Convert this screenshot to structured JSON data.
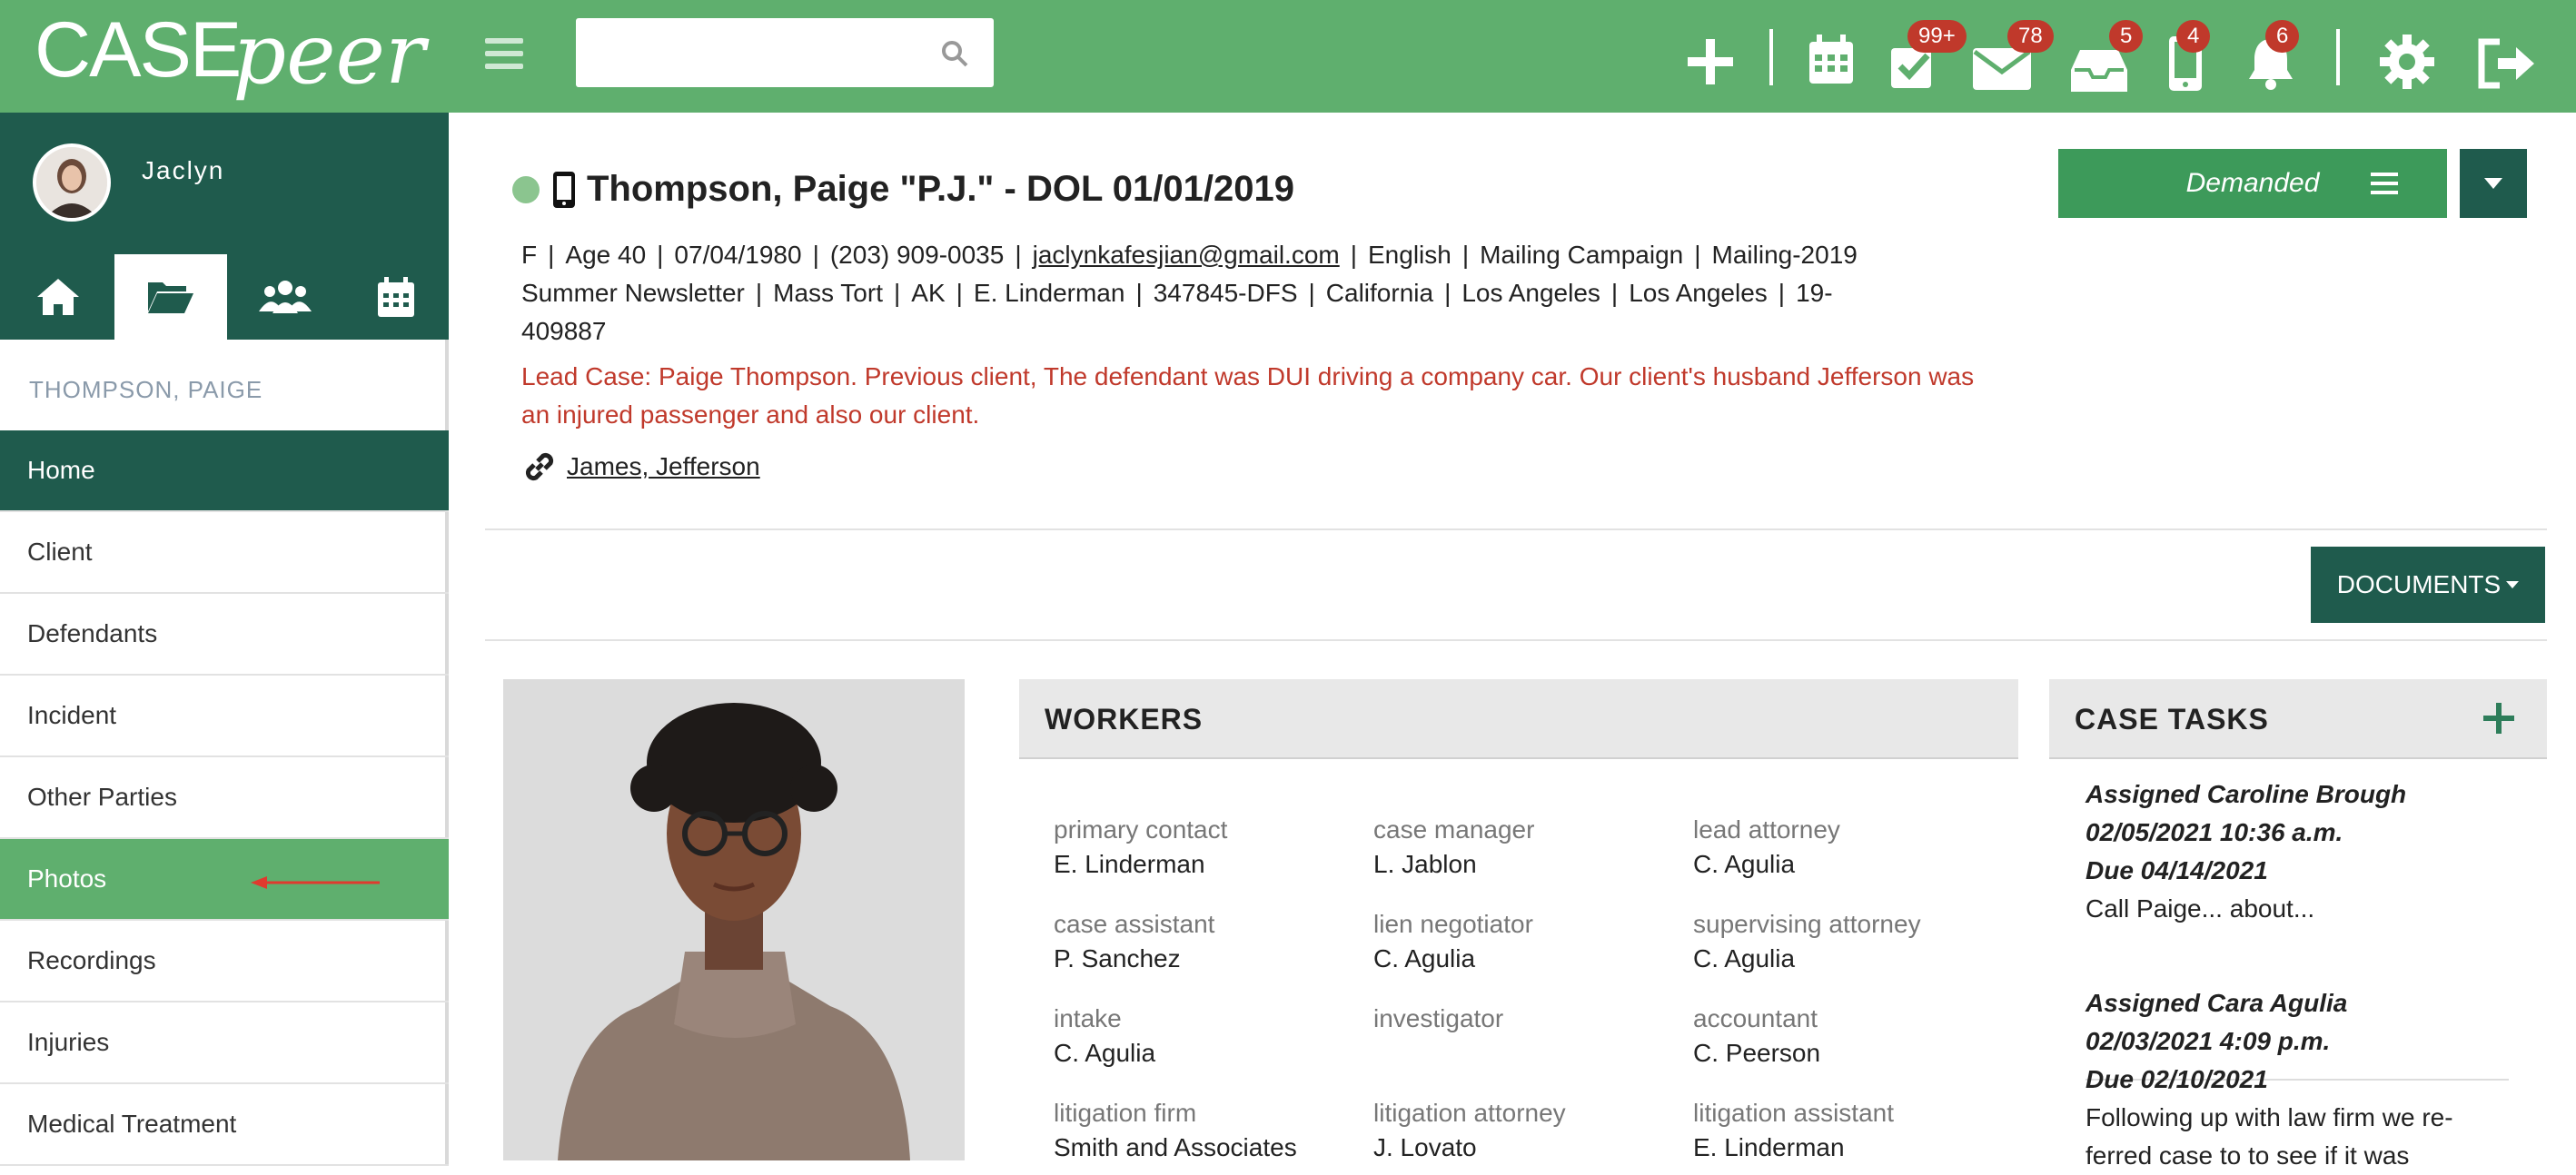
{
  "brand": {
    "case": "CASE",
    "peer": "peer"
  },
  "search": {
    "placeholder": ""
  },
  "badges": {
    "tasks": "99+",
    "mail": "78",
    "inbox": "5",
    "phone": "4",
    "notifications": "6"
  },
  "user": {
    "name": "Jaclyn"
  },
  "client_label": "THOMPSON, PAIGE",
  "nav": [
    "Home",
    "Client",
    "Defendants",
    "Incident",
    "Other Parties",
    "Photos",
    "Recordings",
    "Injuries",
    "Medical Treatment"
  ],
  "case": {
    "title": "Thompson, Paige \"P.J.\" - DOL 01/01/2019",
    "meta_line1": [
      "F",
      "Age 40",
      "07/04/1980",
      "(203) 909-0035"
    ],
    "email": "jaclynkafesjian@gmail.com",
    "meta_line1b": [
      "English",
      "Mailing Campaign",
      "Mailing-2019"
    ],
    "meta_line2": [
      "Summer Newsletter",
      "Mass Tort",
      "AK",
      "E. Linderman",
      "347845-DFS",
      "California",
      "Los Angeles",
      "Los Angeles",
      "19-"
    ],
    "meta_line3": "409887",
    "lead_note": "Lead Case: Paige Thompson. Previous client, The defendant was DUI driving a company car. Our client's husband Jefferson was an injured passenger and also our client.",
    "linked_case": "James, Jefferson",
    "status": "Demanded",
    "documents_label": "DOCUMENTS"
  },
  "workers": {
    "title": "WORKERS",
    "items": [
      {
        "label": "primary contact",
        "value": "E. Linderman"
      },
      {
        "label": "case manager",
        "value": "L. Jablon"
      },
      {
        "label": "lead attorney",
        "value": "C. Agulia"
      },
      {
        "label": "case assistant",
        "value": "P. Sanchez"
      },
      {
        "label": "lien negotiator",
        "value": "C. Agulia"
      },
      {
        "label": "supervising attorney",
        "value": "C. Agulia"
      },
      {
        "label": "intake",
        "value": "C. Agulia"
      },
      {
        "label": "investigator",
        "value": ""
      },
      {
        "label": "accountant",
        "value": "C. Peerson"
      },
      {
        "label": "litigation firm",
        "value": "Smith and Associates"
      },
      {
        "label": "litigation attorney",
        "value": "J. Lovato"
      },
      {
        "label": "litigation assistant",
        "value": "E. Linderman"
      }
    ]
  },
  "tasks": {
    "title": "CASE TASKS",
    "items": [
      {
        "assigned": "Assigned Caroline Brough",
        "date": "02/05/2021 10:36 a.m.",
        "due": "Due 04/14/2021",
        "text": "Call Paige... about..."
      },
      {
        "assigned": "Assigned Cara Agulia",
        "date": "02/03/2021 4:09 p.m.",
        "due": "Due 02/10/2021",
        "text": "Following up with law firm we re-ferred case to to see if it was"
      }
    ]
  },
  "colors": {
    "brand_green": "#5faf6e",
    "dark_green": "#1f5b4d",
    "alert_red": "#c0392b"
  },
  "icons": [
    "search-icon",
    "plus-icon",
    "calendar-icon",
    "task-check-icon",
    "mail-icon",
    "inbox-icon",
    "phone-icon",
    "bell-icon",
    "gear-icon",
    "logout-icon",
    "home-icon",
    "folder-icon",
    "users-icon",
    "calendar-small-icon",
    "mobile-icon",
    "link-icon",
    "chevron-down-icon"
  ]
}
